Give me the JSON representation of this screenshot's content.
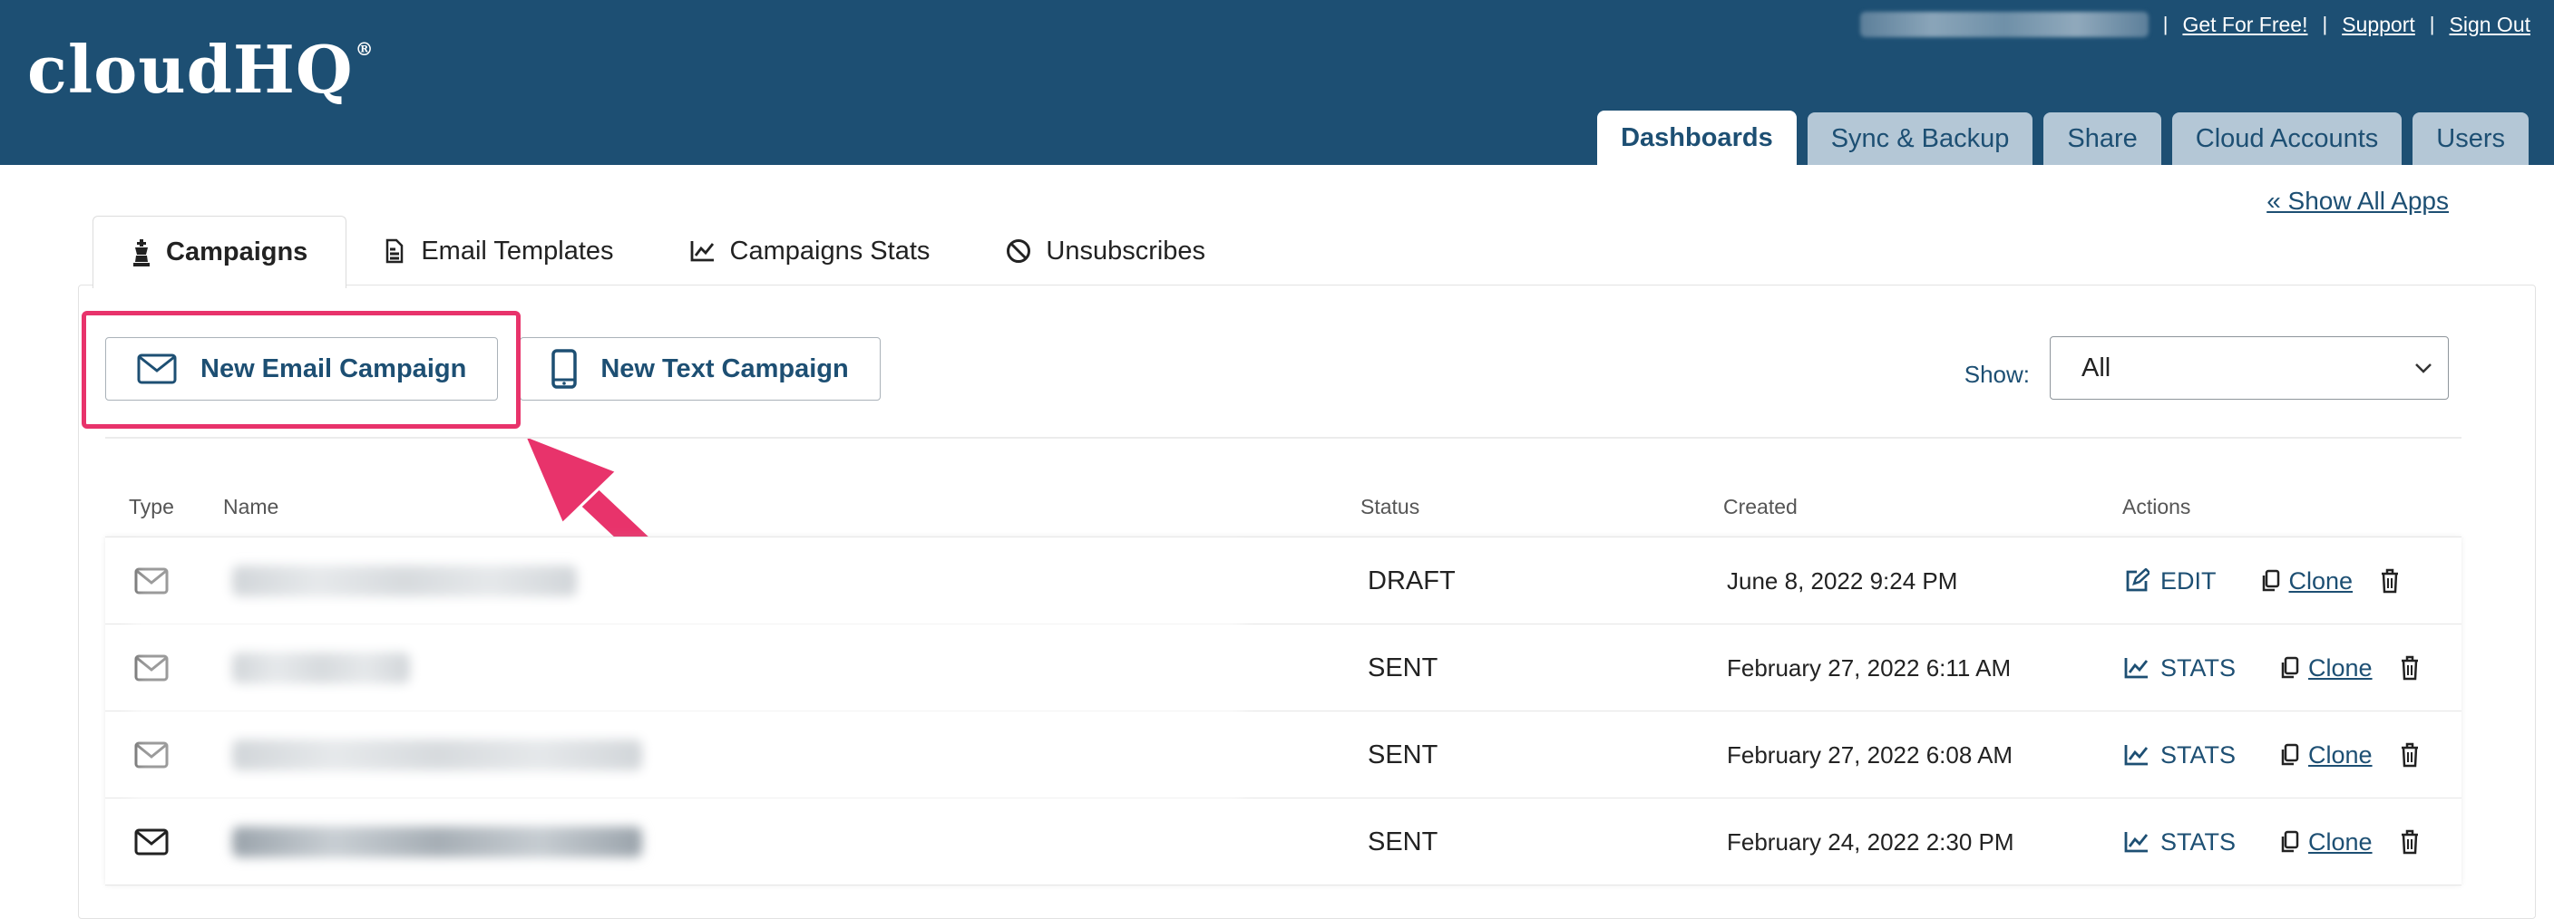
{
  "header": {
    "logo_text": "cloudHQ",
    "logo_reg": "®",
    "top_links": {
      "separator": "|",
      "get_free": "Get For Free!",
      "support": "Support",
      "sign_out": "Sign Out"
    },
    "tabs": [
      {
        "label": "Dashboards",
        "active": true
      },
      {
        "label": "Sync & Backup",
        "active": false
      },
      {
        "label": "Share",
        "active": false
      },
      {
        "label": "Cloud Accounts",
        "active": false
      },
      {
        "label": "Users",
        "active": false
      }
    ]
  },
  "show_all_apps": "« Show All Apps",
  "sub_tabs": [
    {
      "label": "Campaigns",
      "icon": "chess-king-icon",
      "active": true
    },
    {
      "label": "Email Templates",
      "icon": "template-icon",
      "active": false
    },
    {
      "label": "Campaigns Stats",
      "icon": "line-chart-icon",
      "active": false
    },
    {
      "label": "Unsubscribes",
      "icon": "ban-icon",
      "active": false
    }
  ],
  "buttons": {
    "new_email_campaign": "New Email Campaign",
    "new_text_campaign": "New Text Campaign"
  },
  "filter": {
    "label": "Show:",
    "selected": "All"
  },
  "table": {
    "columns": {
      "type": "Type",
      "name": "Name",
      "status": "Status",
      "created": "Created",
      "actions": "Actions"
    },
    "clone_label": "Clone",
    "rows": [
      {
        "type_icon": "envelope-icon",
        "status": "DRAFT",
        "created": "June 8, 2022 9:24 PM",
        "action": "EDIT",
        "action_icon": "edit-icon"
      },
      {
        "type_icon": "envelope-icon",
        "status": "SENT",
        "created": "February 27, 2022 6:11 AM",
        "action": "STATS",
        "action_icon": "line-chart-icon"
      },
      {
        "type_icon": "envelope-icon",
        "status": "SENT",
        "created": "February 27, 2022 6:08 AM",
        "action": "STATS",
        "action_icon": "line-chart-icon"
      },
      {
        "type_icon": "envelope-icon",
        "status": "SENT",
        "created": "February 24, 2022 2:30 PM",
        "action": "STATS",
        "action_icon": "line-chart-icon"
      }
    ]
  },
  "colors": {
    "brand": "#1d4f73",
    "highlight": "#e8336b",
    "inactive_tab": "#b4c7d6"
  }
}
